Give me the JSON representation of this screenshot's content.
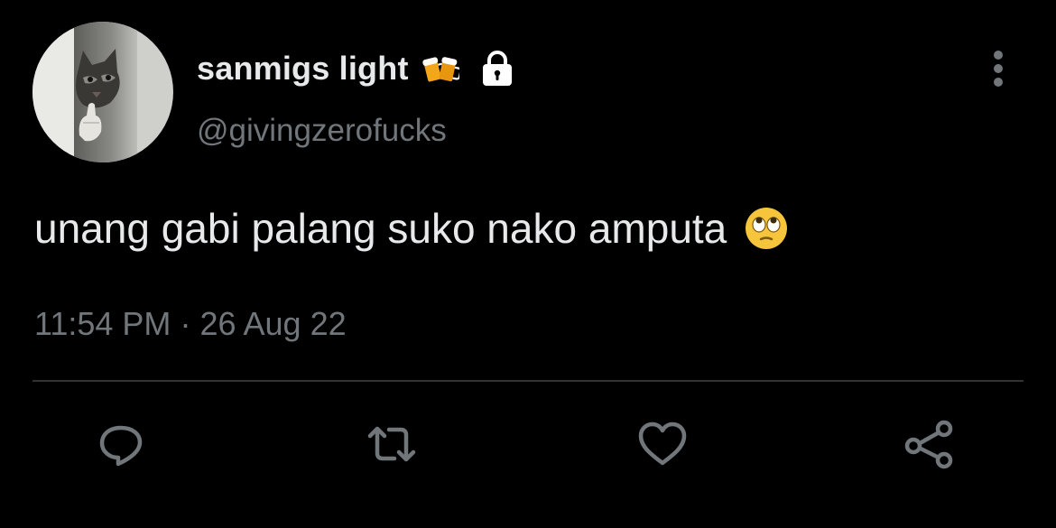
{
  "tweet": {
    "display_name": "sanmigs light",
    "handle": "@givingzerofucks",
    "text": "unang gabi palang suko nako amputa",
    "time": "11:54 PM",
    "separator": "·",
    "date": "26 Aug 22",
    "name_badges": [
      "beer-mugs-icon",
      "lock-icon"
    ],
    "text_emoji": "face-with-rolling-eyes-icon"
  },
  "actions": [
    "reply-icon",
    "retweet-icon",
    "like-icon",
    "share-icon"
  ],
  "colors": {
    "background": "#000000",
    "primary_text": "#e7e9ea",
    "secondary_text": "#71767b",
    "divider": "#2f3336"
  }
}
